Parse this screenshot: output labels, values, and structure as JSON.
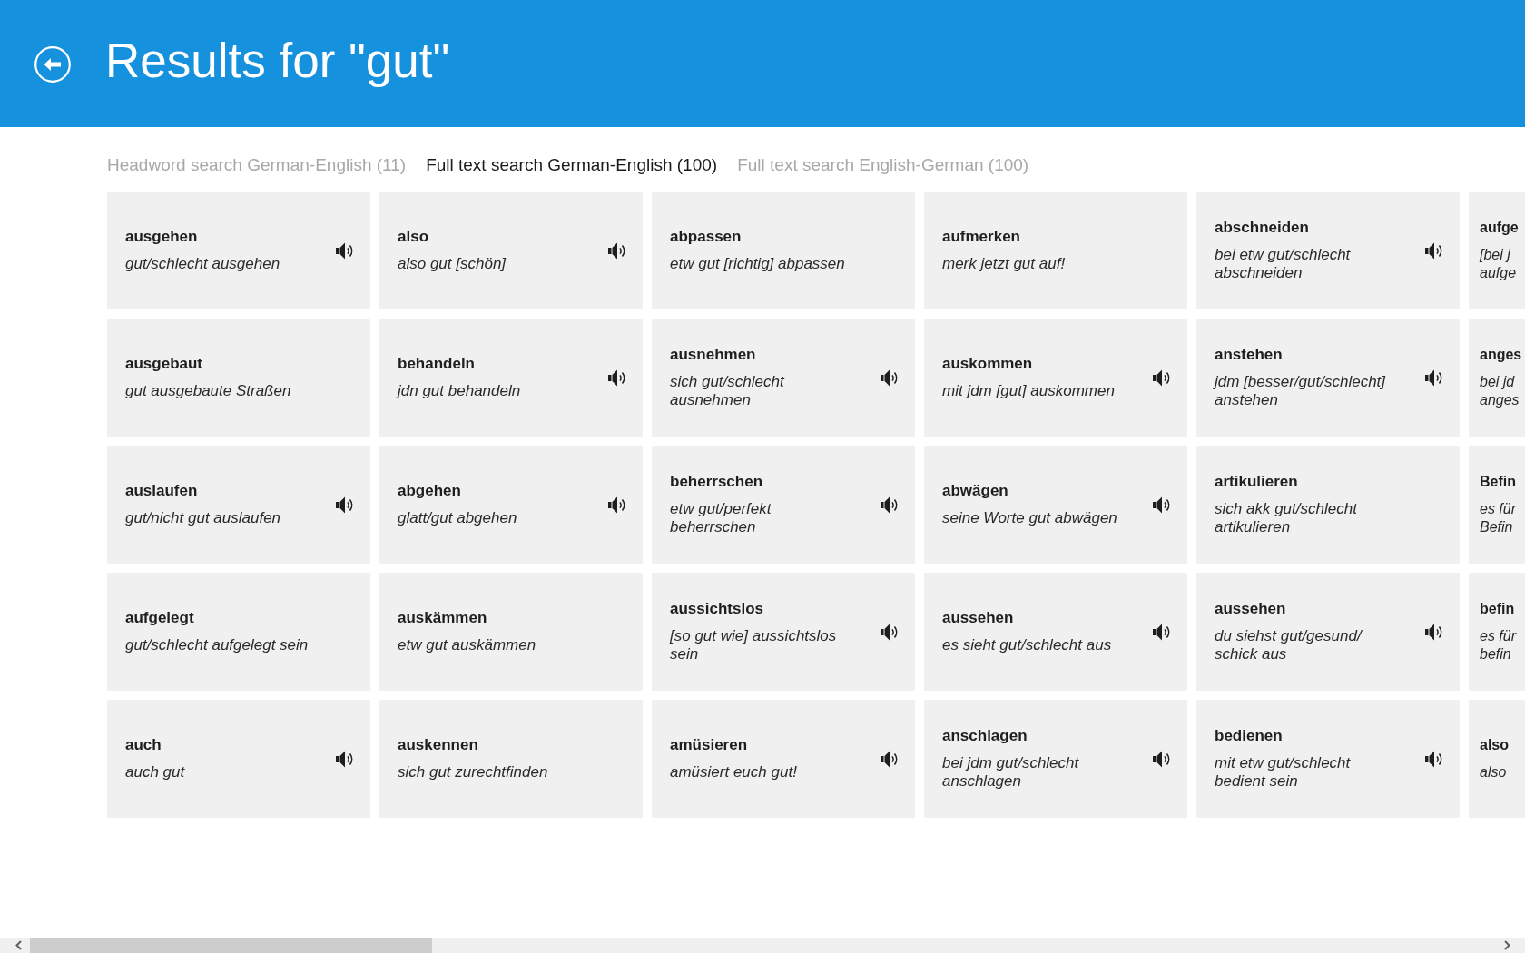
{
  "header": {
    "title": "Results for \"gut\""
  },
  "tabs": [
    {
      "label": "Headword search German-English (11)",
      "selected": false
    },
    {
      "label": "Full text search German-English (100)",
      "selected": true
    },
    {
      "label": "Full text search English-German (100)",
      "selected": false
    }
  ],
  "results": [
    {
      "headword": "ausgehen",
      "example": "gut/schlecht ausgehen",
      "audio": true
    },
    {
      "headword": "also",
      "example": "also gut [schön]",
      "audio": true
    },
    {
      "headword": "abpassen",
      "example": "etw gut [richtig] abpassen",
      "audio": false
    },
    {
      "headword": "aufmerken",
      "example": "merk jetzt gut auf!",
      "audio": false
    },
    {
      "headword": "abschneiden",
      "example": "bei etw gut/schlecht abschneiden",
      "audio": true
    },
    {
      "headword": "aufge",
      "example": "[bei j aufge"
    },
    {
      "headword": "ausgebaut",
      "example": "gut ausgebaute Straßen",
      "audio": false
    },
    {
      "headword": "behandeln",
      "example": "jdn gut behandeln",
      "audio": true
    },
    {
      "headword": "ausnehmen",
      "example": "sich gut/schlecht ausnehmen",
      "audio": true
    },
    {
      "headword": "auskommen",
      "example": "mit jdm [gut] auskommen",
      "audio": true
    },
    {
      "headword": "anstehen",
      "example": "jdm [besser/gut/schlecht] anstehen",
      "audio": true
    },
    {
      "headword": "anges",
      "example": "bei jd anges"
    },
    {
      "headword": "auslaufen",
      "example": "gut/nicht gut auslaufen",
      "audio": true
    },
    {
      "headword": "abgehen",
      "example": "glatt/gut abgehen",
      "audio": true
    },
    {
      "headword": "beherrschen",
      "example": "etw gut/perfekt beherrschen",
      "audio": true
    },
    {
      "headword": "abwägen",
      "example": "seine Worte gut abwägen",
      "audio": true
    },
    {
      "headword": "artikulieren",
      "example": "sich akk gut/schlecht artikulieren",
      "audio": false
    },
    {
      "headword": "Befin",
      "example": "es für Befin"
    },
    {
      "headword": "aufgelegt",
      "example": "gut/schlecht aufgelegt sein",
      "audio": false
    },
    {
      "headword": "auskämmen",
      "example": "etw gut auskämmen",
      "audio": false
    },
    {
      "headword": "aussichtslos",
      "example": "[so gut wie] aussichtslos sein",
      "audio": true
    },
    {
      "headword": "aussehen",
      "example": "es sieht gut/schlecht aus",
      "audio": true
    },
    {
      "headword": "aussehen",
      "example": "du siehst gut/gesund/ schick aus",
      "audio": true
    },
    {
      "headword": "befin",
      "example": "es für befin"
    },
    {
      "headword": "auch",
      "example": "auch gut",
      "audio": true
    },
    {
      "headword": "auskennen",
      "example": "sich gut zurechtfinden",
      "audio": false
    },
    {
      "headword": "amüsieren",
      "example": "amüsiert euch gut!",
      "audio": true
    },
    {
      "headword": "anschlagen",
      "example": "bei jdm gut/schlecht anschlagen",
      "audio": true
    },
    {
      "headword": "bedienen",
      "example": "mit etw gut/schlecht bedient sein",
      "audio": true
    },
    {
      "headword": "also",
      "example": "also"
    }
  ]
}
